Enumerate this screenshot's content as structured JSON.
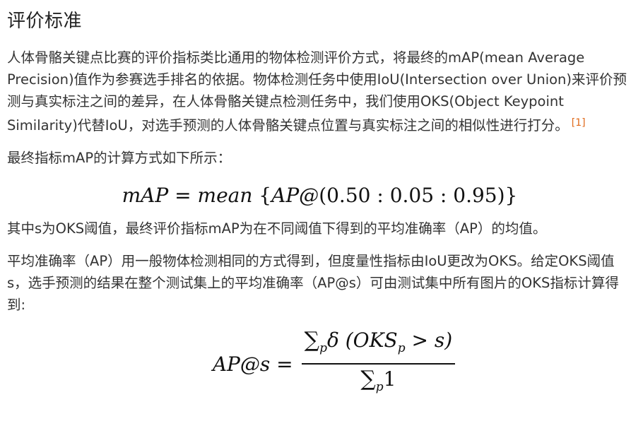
{
  "heading": "评价标准",
  "paragraph1": "人体骨骼关键点比赛的评价指标类比通用的物体检测评价方式，将最终的mAP(mean Average Precision)值作为参赛选手排名的依据。物体检测任务中使用IoU(Intersection over Union)来评价预测与真实标注之间的差异，在人体骨骼关键点检测任务中，我们使用OKS(Object Keypoint Similarity)代替IoU，对选手预测的人体骨骼关键点位置与真实标注之间的相似性进行打分。",
  "reference_marker": "[1]",
  "paragraph2": "最终指标mAP的计算方式如下所示：",
  "formula1": {
    "lhs": "mAP",
    "eq": "=",
    "func": "mean",
    "open": "{",
    "inner": "AP@",
    "args": "(0.50 : 0.05 : 0.95)",
    "close": "}"
  },
  "paragraph3": "其中s为OKS阈值，最终评价指标mAP为在不同阈值下得到的平均准确率（AP）的均值。",
  "paragraph4": "平均准确率（AP）用一般物体检测相同的方式得到，但度量性指标由IoU更改为OKS。给定OKS阈值s，选手预测的结果在整个测试集上的平均准确率（AP@s）可由测试集中所有图片的OKS指标计算得到:",
  "formula2": {
    "lhs": "AP@s",
    "eq": "=",
    "sum": "∑",
    "sub": "p",
    "delta": "δ",
    "num_args": "(OKS",
    "num_sub": "p",
    "num_tail": " > s)",
    "den_one": "1"
  }
}
